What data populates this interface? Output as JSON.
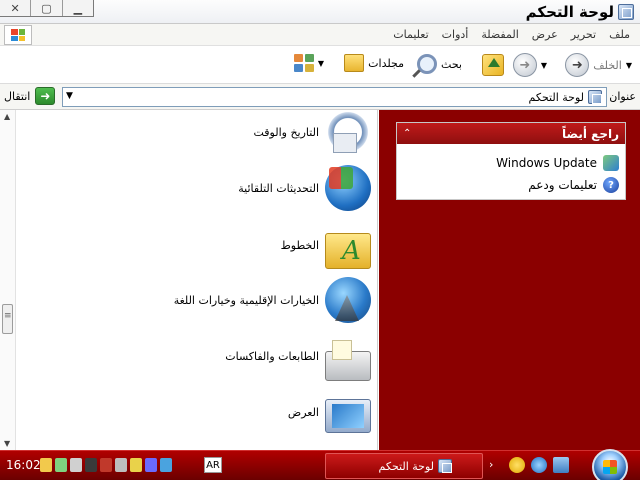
{
  "window": {
    "title": "لوحة التحكم",
    "controls": [
      "close",
      "maximize",
      "minimize"
    ]
  },
  "menubar": {
    "items": [
      "ملف",
      "تحرير",
      "عرض",
      "المفضلة",
      "أدوات",
      "تعليمات"
    ]
  },
  "toolbar": {
    "back_label": "الخلف",
    "search_label": "بحث",
    "folders_label": "مجلدات"
  },
  "address": {
    "label": "عنوان",
    "value": "لوحة التحكم",
    "go_label": "انتقال"
  },
  "items": [
    {
      "label": "التاريخ والوقت",
      "icon": "date-time-icon"
    },
    {
      "label": "التحديثات التلقائية",
      "icon": "automatic-updates-icon"
    },
    {
      "label": "الخطوط",
      "icon": "fonts-folder-icon"
    },
    {
      "label": "الخيارات الإقليمية وخيارات اللغة",
      "icon": "regional-options-icon"
    },
    {
      "label": "الطابعات والفاكسات",
      "icon": "printers-icon"
    },
    {
      "label": "العرض",
      "icon": "display-icon"
    }
  ],
  "see_also": {
    "title": "راجع أيضاً",
    "items": [
      {
        "label": "Windows Update",
        "icon": "windows-update-icon"
      },
      {
        "label": "تعليمات ودعم",
        "icon": "help-icon"
      }
    ]
  },
  "taskbar": {
    "time": "16:02",
    "language": "AR",
    "task_label": "لوحة التحكم"
  },
  "colors": {
    "panel_bg": "#8b0000",
    "taskbar": "#8e0000",
    "header": "#c01a1a"
  }
}
